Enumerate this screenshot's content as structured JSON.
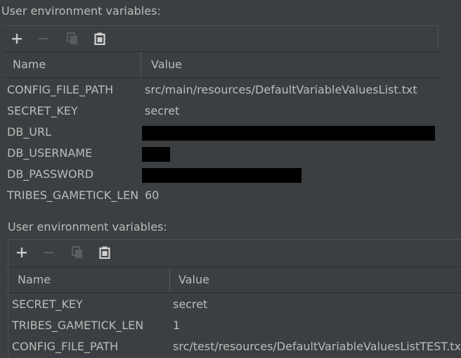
{
  "panels": [
    {
      "title": "User environment variables:",
      "toolbar": {
        "add": "add-icon",
        "remove": "remove-icon",
        "copy": "copy-icon",
        "paste": "paste-icon"
      },
      "columns": {
        "name": "Name",
        "value": "Value"
      },
      "rows": [
        {
          "name": "CONFIG_FILE_PATH",
          "value": "src/main/resources/DefaultVariableValuesList.txt",
          "redacted": false
        },
        {
          "name": "SECRET_KEY",
          "value": "secret",
          "redacted": false
        },
        {
          "name": "DB_URL",
          "value": "",
          "redacted": true
        },
        {
          "name": "DB_USERNAME",
          "value": "",
          "redacted": true
        },
        {
          "name": "DB_PASSWORD",
          "value": "",
          "redacted": true
        },
        {
          "name": "TRIBES_GAMETICK_LEN",
          "value": "60",
          "redacted": false
        }
      ]
    },
    {
      "title": "User environment variables:",
      "toolbar": {
        "add": "add-icon",
        "remove": "remove-icon",
        "copy": "copy-icon",
        "paste": "paste-icon"
      },
      "columns": {
        "name": "Name",
        "value": "Value"
      },
      "rows": [
        {
          "name": "SECRET_KEY",
          "value": "secret",
          "redacted": false
        },
        {
          "name": "TRIBES_GAMETICK_LEN",
          "value": "1",
          "redacted": false
        },
        {
          "name": "CONFIG_FILE_PATH",
          "value": "src/test/resources/DefaultVariableValuesListTEST.txt",
          "redacted": false
        }
      ]
    }
  ],
  "colors": {
    "background": "#3c3f41",
    "text": "#bbbbbb",
    "icon_enabled": "#c8c8c8",
    "icon_disabled": "#5a5d60",
    "redaction": "#000000"
  }
}
